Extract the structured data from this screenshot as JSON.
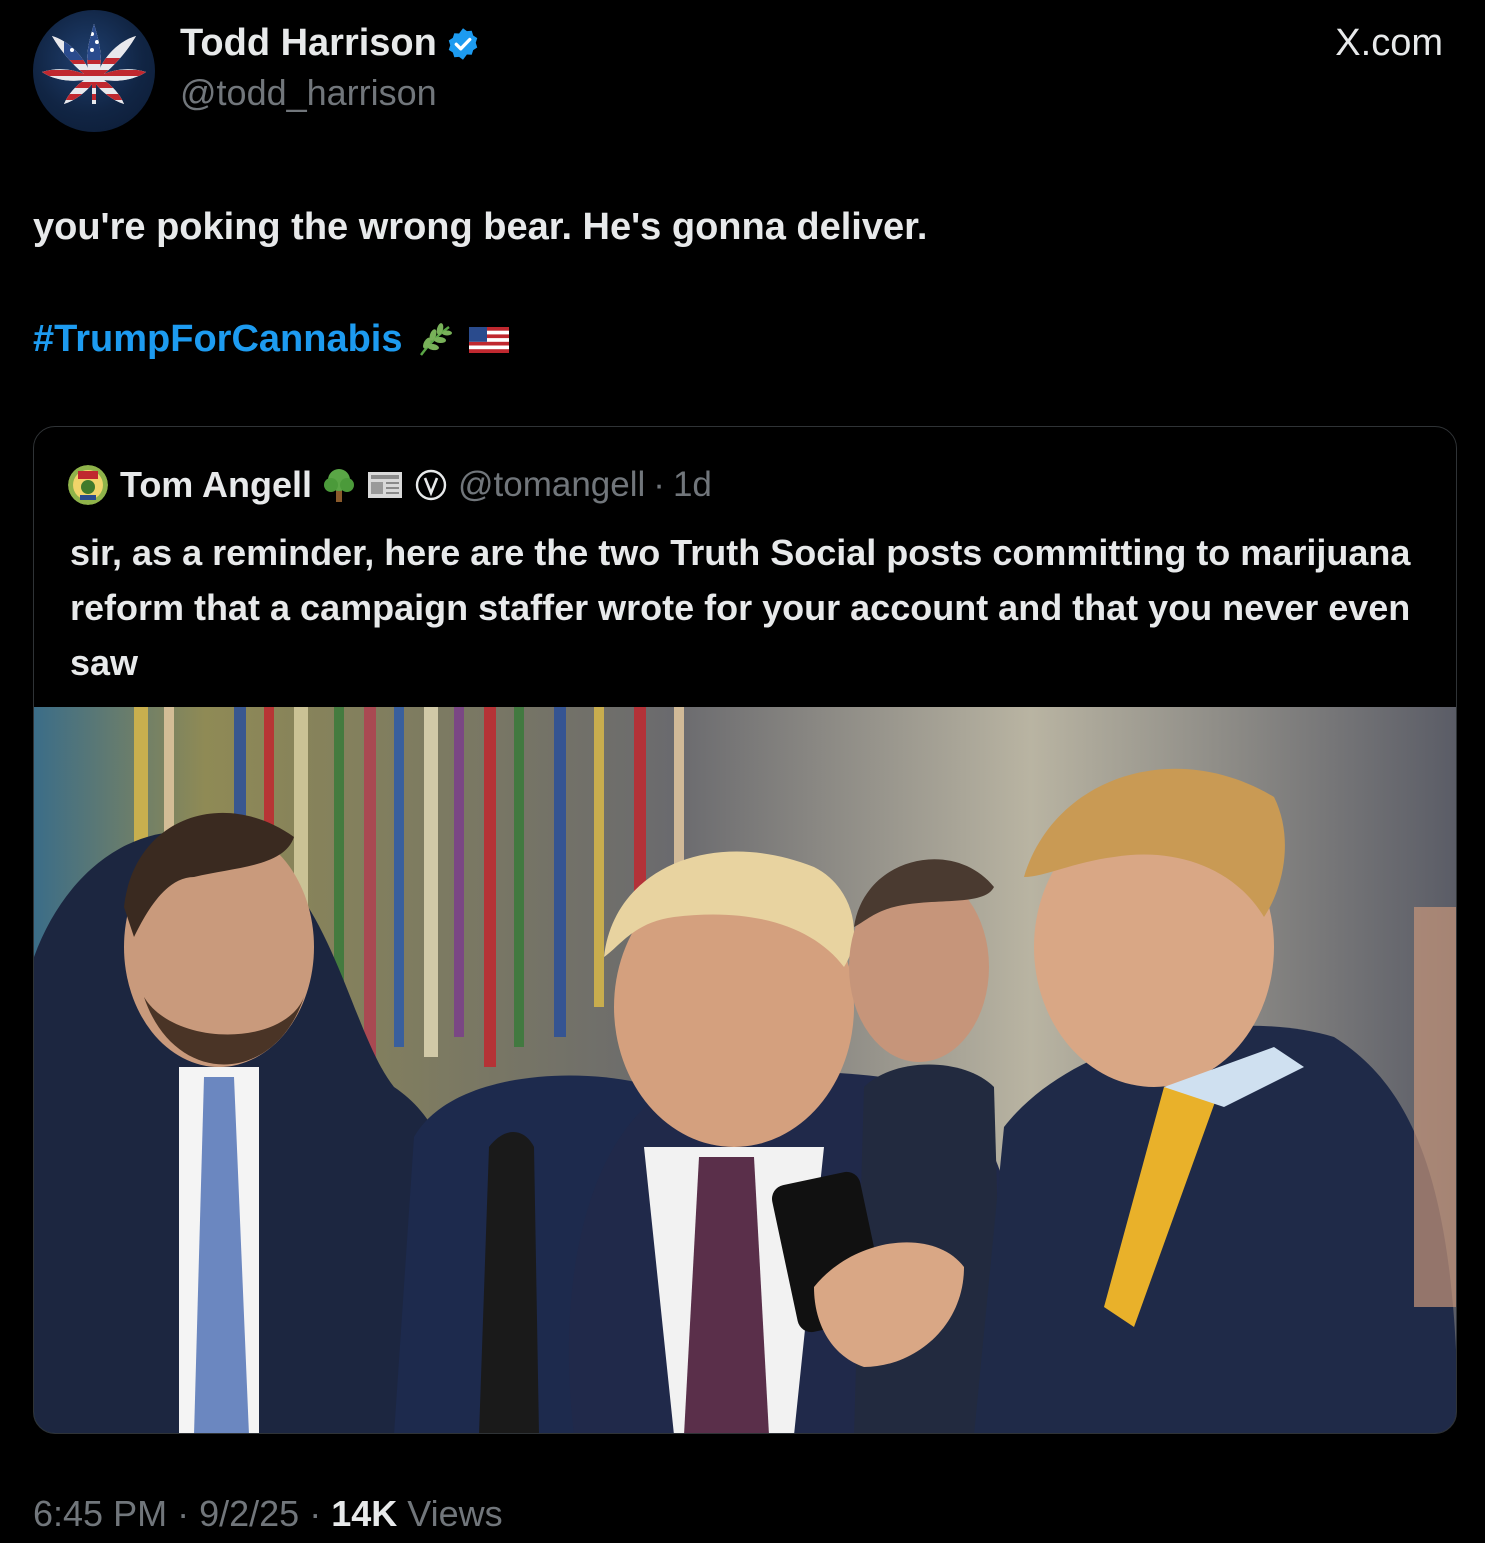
{
  "author": {
    "name": "Todd Harrison",
    "handle": "@todd_harrison",
    "verified_color": "#1d9bf0",
    "avatar_icon": "american-flag-cannabis-leaf-icon"
  },
  "site_label": "X.com",
  "tweet": {
    "text": "you're poking the wrong bear.  He's gonna deliver.",
    "hashtag": "#TrumpForCannabis",
    "emojis": [
      "herb-icon",
      "us-flag-icon"
    ]
  },
  "quoted_tweet": {
    "author_name": "Tom Angell",
    "handle": "@tomangell",
    "separator": "·",
    "age": "1d",
    "name_emojis": [
      "tree-icon",
      "newspaper-icon",
      "circled-v-icon"
    ],
    "text": "sir, as a reminder, here are the two Truth Social posts committing to marijuana reform that a campaign staffer wrote for your account and that you never even saw",
    "media_icon": "oval-office-photo-icon"
  },
  "meta": {
    "time": "6:45 PM",
    "separator": "·",
    "date": "9/2/25",
    "views_count": "14K",
    "views_label": "Views"
  },
  "colors": {
    "background": "#000000",
    "text_primary": "#e7e9ea",
    "text_secondary": "#71767b",
    "accent": "#1d9bf0",
    "border": "#2f3336"
  }
}
